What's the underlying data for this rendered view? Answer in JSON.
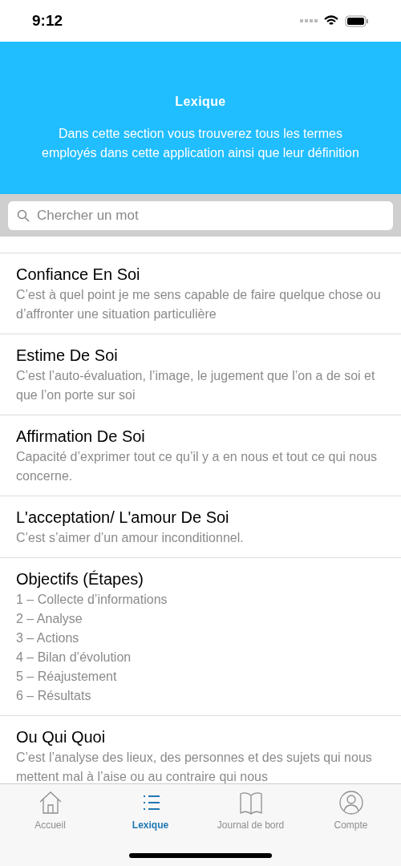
{
  "status_bar": {
    "time": "9:12"
  },
  "header": {
    "title": "Lexique",
    "subtitle": "Dans cette section vous trouverez tous les termes employés dans cette application ainsi que leur définition"
  },
  "search": {
    "placeholder": "Chercher un mot"
  },
  "terms": [
    {
      "kind": "definition",
      "term": "Confiance En Soi",
      "description": "C’est à quel point je me sens capable de faire quelque chose ou d’affronter une situation particulière"
    },
    {
      "kind": "definition",
      "term": "Estime De Soi",
      "description": "C’est l’auto-évaluation, l’image, le jugement que l’on a de soi et que l’on porte sur soi"
    },
    {
      "kind": "definition",
      "term": "Affirmation De Soi",
      "description": "Capacité d’exprimer tout ce qu’il y a en nous et tout ce qui nous concerne."
    },
    {
      "kind": "definition",
      "term": "L'acceptation/ L'amour De Soi",
      "description": "C’est s’aimer d’un amour inconditionnel."
    },
    {
      "kind": "steps",
      "term": "Objectifs (Étapes)",
      "steps": [
        "1 – Collecte d’informations",
        "2 – Analyse",
        "3 – Actions",
        "4 – Bilan d’évolution",
        "5 – Réajustement",
        "6 – Résultats"
      ]
    },
    {
      "kind": "definition",
      "term": "Ou Qui Quoi",
      "description": "C’est l’analyse des lieux, des personnes et des sujets qui nous mettent mal à l’aise ou au contraire qui nous"
    }
  ],
  "tabs": [
    {
      "kind": "home",
      "label": "Accueil",
      "selected": false
    },
    {
      "kind": "list",
      "label": "Lexique",
      "selected": true
    },
    {
      "kind": "book",
      "label": "Journal de bord",
      "selected": false
    },
    {
      "kind": "user",
      "label": "Compte",
      "selected": false
    }
  ]
}
